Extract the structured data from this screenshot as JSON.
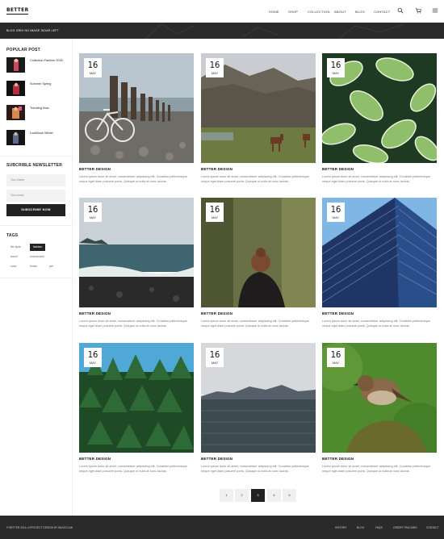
{
  "header": {
    "logo": "BETTER",
    "nav": [
      "HOME",
      "SHOP",
      "COLLECTION",
      "ABOUT",
      "BLOG",
      "CONTACT"
    ]
  },
  "banner": {
    "text": "BLOG GRID NO IMAGE SIDAR LEFT"
  },
  "sidebar": {
    "popular_title": "POPULAR POST",
    "posts": [
      "Collection Fashion 2016",
      "Summer Spring",
      "Trending Now",
      "LookBook Winter"
    ],
    "newsletter_title": "SUBCRIBLE NEWSLETTER",
    "name_placeholder": "Your Name",
    "email_placeholder": "Your email",
    "subscribe_label": "SUBSCRIBE NOW",
    "tags_title": "TAGS",
    "tags": [
      "life style",
      "fashion",
      "travel",
      "smartcosmt",
      "color",
      "flower",
      "pet"
    ],
    "active_tag": "fashion"
  },
  "cards": [
    {
      "day": "16",
      "month": "MAY",
      "title": "BETTER DESIGN",
      "text": "Lorem ipsum dolor sit amet, consectetuer adipiscing elit. Curabitur pellentesque neque eget diam posuere porta. Quisque ut nulla at nunc lacinia."
    },
    {
      "day": "16",
      "month": "MAY",
      "title": "BETTER DESIGN",
      "text": "Lorem ipsum dolor sit amet, consectetuer adipiscing elit. Curabitur pellentesque neque eget diam posuere porta. Quisque ut nulla at nunc lacinia."
    },
    {
      "day": "16",
      "month": "MAY",
      "title": "BETTER DESIGN",
      "text": "Lorem ipsum dolor sit amet, consectetuer adipiscing elit. Curabitur pellentesque neque eget diam posuere porta. Quisque ut nulla at nunc lacinia."
    },
    {
      "day": "16",
      "month": "MAY",
      "title": "BETTER DESIGN",
      "text": "Lorem ipsum dolor sit amet, consectetuer adipiscing elit. Curabitur pellentesque neque eget diam posuere porta. Quisque ut nulla at nunc lacinia."
    },
    {
      "day": "16",
      "month": "MAY",
      "title": "BETTER DESIGN",
      "text": "Lorem ipsum dolor sit amet, consectetuer adipiscing elit. Curabitur pellentesque neque eget diam posuere porta. Quisque ut nulla at nunc lacinia."
    },
    {
      "day": "16",
      "month": "MAY",
      "title": "BETTER DESIGN",
      "text": "Lorem ipsum dolor sit amet, consectetuer adipiscing elit. Curabitur pellentesque neque eget diam posuere porta. Quisque ut nulla at nunc lacinia."
    },
    {
      "day": "16",
      "month": "MAY",
      "title": "BETTER DESIGN",
      "text": "Lorem ipsum dolor sit amet, consectetuer adipiscing elit. Curabitur pellentesque neque eget diam posuere porta. Quisque ut nulla at nunc lacinia."
    },
    {
      "day": "16",
      "month": "MAY",
      "title": "BETTER DESIGN",
      "text": "Lorem ipsum dolor sit amet, consectetuer adipiscing elit. Curabitur pellentesque neque eget diam posuere porta. Quisque ut nulla at nunc lacinia."
    },
    {
      "day": "16",
      "month": "MAY",
      "title": "BETTER DESIGN",
      "text": "Lorem ipsum dolor sit amet, consectetuer adipiscing elit. Curabitur pellentesque neque eget diam posuere porta. Quisque ut nulla at nunc lacinia."
    }
  ],
  "pagination": [
    "1",
    "2",
    "3",
    "4",
    "5"
  ],
  "current_page": "3",
  "footer": {
    "copyright": "© BETTER 2016. A PROJECT DESIGN BY BACKCLAB",
    "links": [
      "HISTORY",
      "BLOG",
      "FAQS",
      "ORDER TRACKING",
      "CONTACT"
    ]
  }
}
